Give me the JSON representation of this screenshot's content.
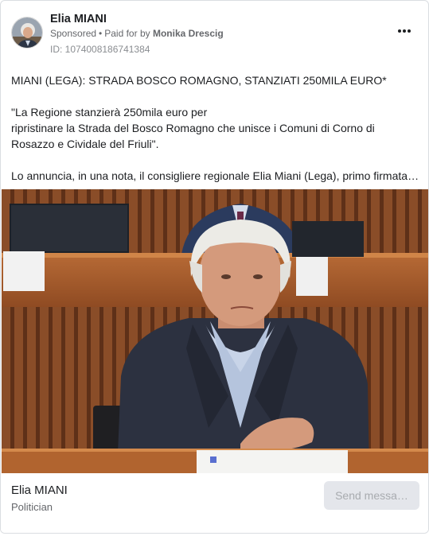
{
  "ad": {
    "page_name": "Elia MIANI",
    "sponsored_label": "Sponsored",
    "separator": "•",
    "paid_for_prefix": "Paid for by",
    "payer": "Monika Drescig",
    "ad_id": "ID: 1074008186741384",
    "more_icon": "more-horizontal-icon"
  },
  "post": {
    "headline": "MIANI (LEGA): STRADA BOSCO ROMAGNO, STANZIATI 250MILA EURO*",
    "quote_line1": "\"La Regione stanzierà 250mila euro per",
    "quote_line2": "ripristinare la Strada del Bosco Romagno che unisce i Comuni di Corno di Rosazzo e Cividale del Friuli\".",
    "body_truncated": "Lo annuncia, in una nota, il consigliere regionale Elia Miani (Lega), primo firmatari…"
  },
  "footer": {
    "page_name": "Elia MIANI",
    "category": "Politician",
    "cta_label": "Send messa…"
  },
  "colors": {
    "text_primary": "#1c1e21",
    "text_secondary": "#65676b",
    "button_bg": "#e4e6eb",
    "button_text_disabled": "#a8abaf"
  }
}
